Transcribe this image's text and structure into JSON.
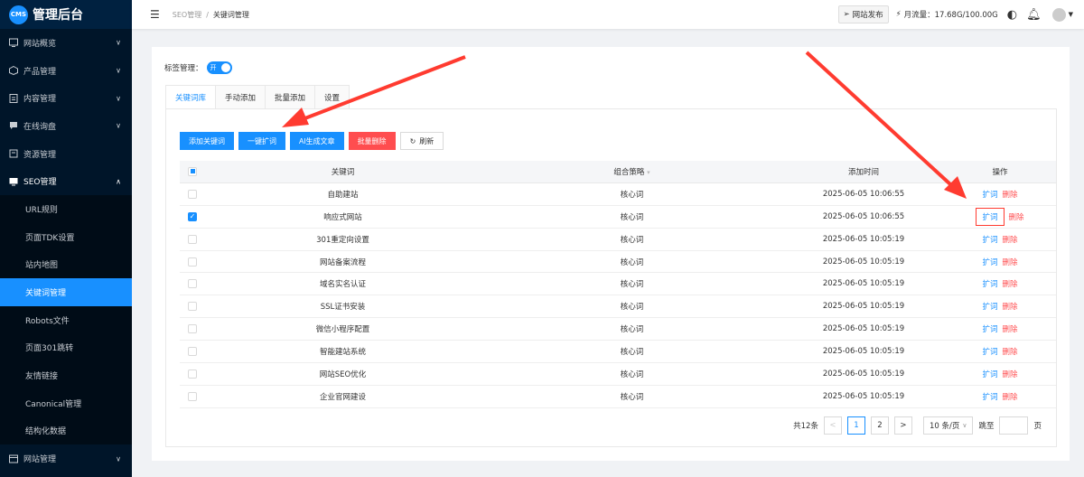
{
  "brand": {
    "badge": "CMS",
    "title": "管理后台"
  },
  "sidebar": {
    "items_top": [
      {
        "label": "网站概览",
        "icon": "chart-icon",
        "arrow": "∨"
      },
      {
        "label": "产品管理",
        "icon": "cube-icon",
        "arrow": "∨"
      },
      {
        "label": "内容管理",
        "icon": "doc-icon",
        "arrow": "∨"
      },
      {
        "label": "在线询盘",
        "icon": "chat-icon",
        "arrow": "∨"
      },
      {
        "label": "资源管理",
        "icon": "folder-icon",
        "arrow": ""
      },
      {
        "label": "SEO管理",
        "icon": "monitor-icon",
        "arrow": "∧"
      }
    ],
    "sub_items": [
      "URL规则",
      "页面TDK设置",
      "站内地图",
      "关键词管理",
      "Robots文件",
      "页面301跳转",
      "友情链接",
      "Canonical管理",
      "结构化数据"
    ],
    "active_sub": "关键词管理",
    "items_bottom": [
      {
        "label": "网站管理",
        "icon": "settings-icon",
        "arrow": "∨"
      }
    ]
  },
  "header": {
    "breadcrumb_parent": "SEO管理",
    "breadcrumb_sep": "/",
    "breadcrumb_current": "关键词管理",
    "publish": "网站发布",
    "traffic": "月流量：17.68G/100.00G"
  },
  "main": {
    "tag_label": "标签管理：",
    "tag_switch": "开",
    "tabs": [
      "关键词库",
      "手动添加",
      "批量添加",
      "设置"
    ],
    "active_tab": "关键词库",
    "buttons": {
      "add": "添加关键词",
      "expand": "一键扩词",
      "ai": "AI生成文章",
      "batch_delete": "批量删除",
      "refresh": "刷新"
    },
    "table": {
      "headers": {
        "keyword": "关键词",
        "strategy": "组合策略",
        "time": "添加时间",
        "ops": "操作"
      },
      "op_expand": "扩词",
      "op_delete": "删除",
      "rows": [
        {
          "keyword": "自助建站",
          "strategy": "核心词",
          "time": "2025-06-05 10:06:55",
          "checked": false
        },
        {
          "keyword": "响应式网站",
          "strategy": "核心词",
          "time": "2025-06-05 10:06:55",
          "checked": true
        },
        {
          "keyword": "301重定向设置",
          "strategy": "核心词",
          "time": "2025-06-05 10:05:19",
          "checked": false
        },
        {
          "keyword": "网站备案流程",
          "strategy": "核心词",
          "time": "2025-06-05 10:05:19",
          "checked": false
        },
        {
          "keyword": "域名实名认证",
          "strategy": "核心词",
          "time": "2025-06-05 10:05:19",
          "checked": false
        },
        {
          "keyword": "SSL证书安装",
          "strategy": "核心词",
          "time": "2025-06-05 10:05:19",
          "checked": false
        },
        {
          "keyword": "微信小程序配置",
          "strategy": "核心词",
          "time": "2025-06-05 10:05:19",
          "checked": false
        },
        {
          "keyword": "智能建站系统",
          "strategy": "核心词",
          "time": "2025-06-05 10:05:19",
          "checked": false
        },
        {
          "keyword": "网站SEO优化",
          "strategy": "核心词",
          "time": "2025-06-05 10:05:19",
          "checked": false
        },
        {
          "keyword": "企业官网建设",
          "strategy": "核心词",
          "time": "2025-06-05 10:05:19",
          "checked": false
        }
      ]
    },
    "pager": {
      "total": "共12条",
      "prev": "<",
      "pages": [
        "1",
        "2"
      ],
      "next": ">",
      "page_size": "10 条/页",
      "goto": "跳至",
      "unit": "页"
    }
  },
  "colors": {
    "primary": "#1890ff",
    "danger": "#ff4d4f",
    "sidebar": "#001529",
    "annotation": "#ff3b30"
  }
}
